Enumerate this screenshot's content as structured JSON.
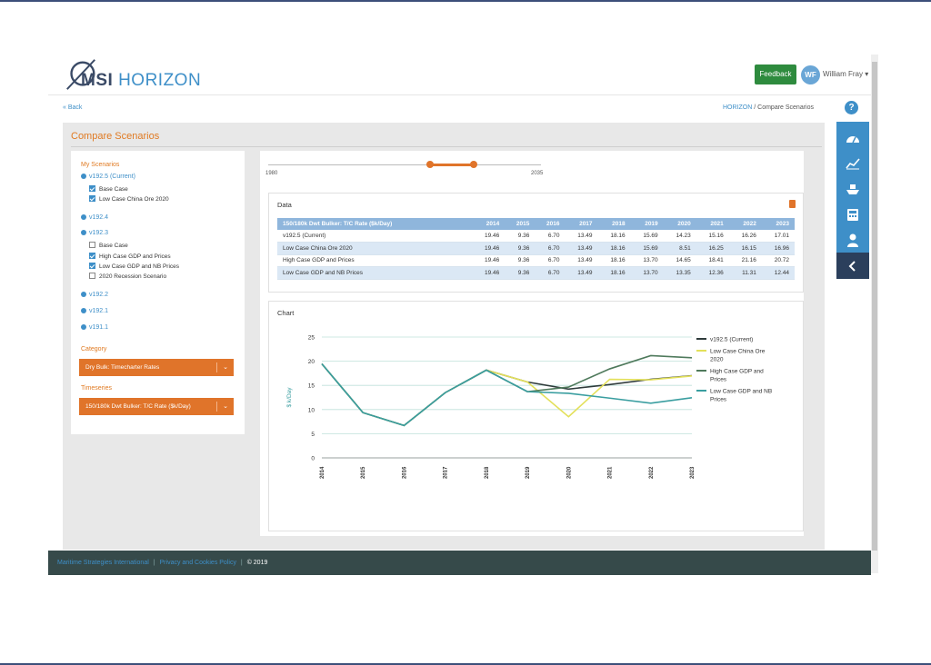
{
  "app": {
    "logo_msi": "MSI",
    "logo_horizon": "HORIZON",
    "feedback_label": "Feedback",
    "avatar_initials": "WF",
    "user_name": "William Fray ▾"
  },
  "nav": {
    "back_label": "« Back",
    "breadcrumb_home": "HORIZON",
    "breadcrumb_sep": "/",
    "breadcrumb_current": "Compare Scenarios",
    "help_label": "?"
  },
  "page": {
    "title": "Compare Scenarios"
  },
  "scenarios": {
    "heading": "My Scenarios",
    "versions": [
      {
        "label": "v192.5 (Current)",
        "items": [
          {
            "label": "Base Case",
            "checked": true
          },
          {
            "label": "Low Case China Ore 2020",
            "checked": true
          }
        ]
      },
      {
        "label": "v192.4",
        "items": []
      },
      {
        "label": "v192.3",
        "items": [
          {
            "label": "Base Case",
            "checked": false
          },
          {
            "label": "High Case GDP and Prices",
            "checked": true
          },
          {
            "label": "Low Case GDP and NB Prices",
            "checked": true
          },
          {
            "label": "2020 Recession Scenario",
            "checked": false
          }
        ]
      },
      {
        "label": "v192.2",
        "items": []
      },
      {
        "label": "v192.1",
        "items": []
      },
      {
        "label": "v191.1",
        "items": []
      }
    ]
  },
  "filters": {
    "category_label": "Category",
    "category_value": "Dry Bulk: Timecharter Rates",
    "timeseries_label": "Timeseries",
    "timeseries_value": "150/180k Dwt Bulker: T/C Rate ($k/Day)"
  },
  "slider": {
    "min_label": "1980",
    "max_label": "2035",
    "range_start_fraction": 0.64,
    "range_end_fraction": 0.8
  },
  "data_table": {
    "title": "Data",
    "header": [
      "150/180k Dwt Bulker: T/C Rate ($k/Day)",
      "2014",
      "2015",
      "2016",
      "2017",
      "2018",
      "2019",
      "2020",
      "2021",
      "2022",
      "2023"
    ],
    "rows": [
      [
        "v192.5 (Current)",
        "19.46",
        "9.36",
        "6.70",
        "13.49",
        "18.16",
        "15.69",
        "14.23",
        "15.16",
        "16.26",
        "17.01"
      ],
      [
        "Low Case China Ore 2020",
        "19.46",
        "9.36",
        "6.70",
        "13.49",
        "18.16",
        "15.69",
        "8.51",
        "16.25",
        "16.15",
        "16.96"
      ],
      [
        "High Case GDP and Prices",
        "19.46",
        "9.36",
        "6.70",
        "13.49",
        "18.16",
        "13.70",
        "14.65",
        "18.41",
        "21.16",
        "20.72"
      ],
      [
        "Low Case GDP and NB Prices",
        "19.46",
        "9.36",
        "6.70",
        "13.49",
        "18.16",
        "13.70",
        "13.35",
        "12.36",
        "11.31",
        "12.44"
      ]
    ]
  },
  "chart_box": {
    "title": "Chart"
  },
  "chart_data": {
    "type": "line",
    "x": [
      "2014",
      "2015",
      "2016",
      "2017",
      "2018",
      "2019",
      "2020",
      "2021",
      "2022",
      "2023"
    ],
    "ylabel": "$ k/Day",
    "ylim": [
      0,
      25
    ],
    "yticks": [
      "0",
      "5",
      "10",
      "15",
      "20",
      "25"
    ],
    "grid": true,
    "legend_position": "right",
    "series": [
      {
        "name": "v192.5 (Current)",
        "color": "#2f3b3b",
        "values": [
          19.46,
          9.36,
          6.7,
          13.49,
          18.16,
          15.69,
          14.23,
          15.16,
          16.26,
          17.01
        ]
      },
      {
        "name": "Low Case China Ore 2020",
        "color": "#e3e05a",
        "values": [
          19.46,
          9.36,
          6.7,
          13.49,
          18.16,
          15.69,
          8.51,
          16.25,
          16.15,
          16.96
        ]
      },
      {
        "name": "High Case GDP and Prices",
        "color": "#4f7a5c",
        "values": [
          19.46,
          9.36,
          6.7,
          13.49,
          18.16,
          13.7,
          14.65,
          18.41,
          21.16,
          20.72
        ]
      },
      {
        "name": "Low Case GDP and NB Prices",
        "color": "#3a9ea0",
        "values": [
          19.46,
          9.36,
          6.7,
          13.49,
          18.16,
          13.7,
          13.35,
          12.36,
          11.31,
          12.44
        ]
      }
    ]
  },
  "sidebar": {
    "icons": [
      "gauge-icon",
      "chart-icon",
      "ship-icon",
      "calculator-icon",
      "user-icon",
      "collapse-icon"
    ]
  },
  "footer": {
    "company_link": "Maritime Strategies International",
    "sep": "|",
    "privacy_link": "Privacy and Cookies Policy",
    "copyright": "© 2019"
  },
  "colors": {
    "accent": "#e0742a",
    "brand_blue": "#3e8fc8",
    "footer": "#364a4a"
  }
}
